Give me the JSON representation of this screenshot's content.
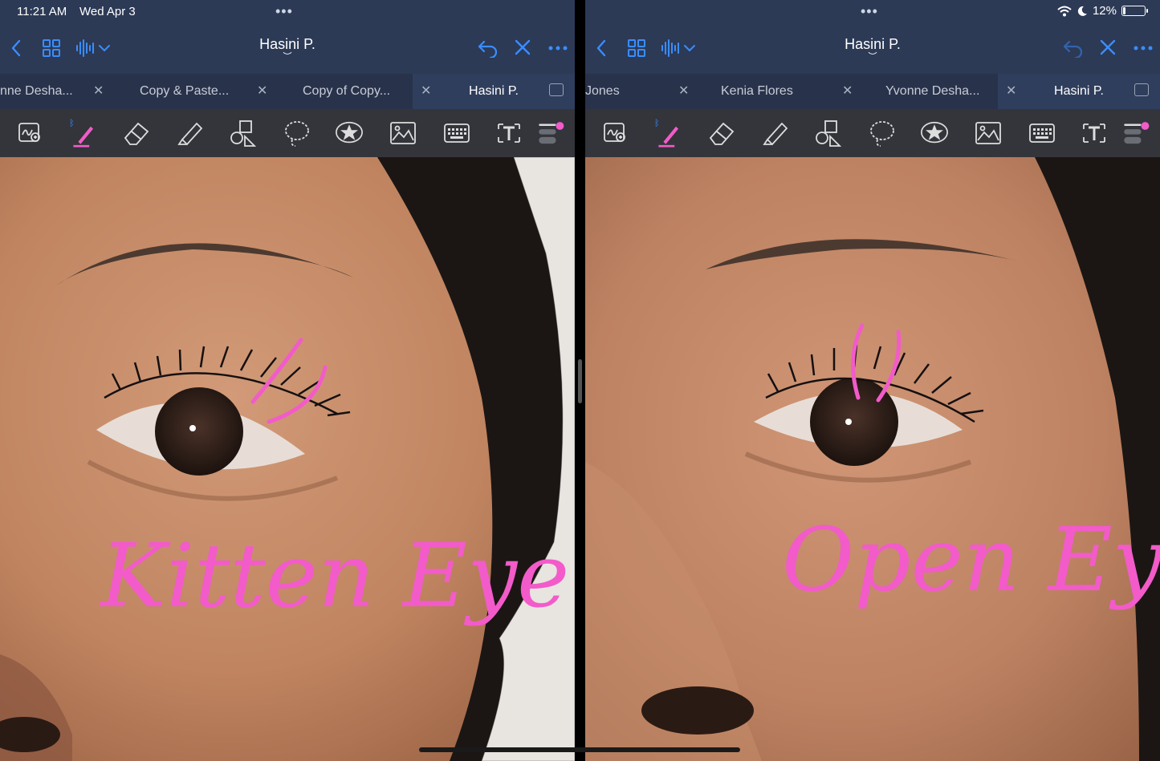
{
  "status": {
    "time": "11:21 AM",
    "date": "Wed Apr 3",
    "battery": "12%",
    "battery_fraction": 0.12
  },
  "colors": {
    "accent": "#3a8dff",
    "ink": "#f25bc9",
    "navbar": "#2c3a56",
    "toolbar": "#33353b"
  },
  "left": {
    "title": "Hasini P.",
    "tabs": [
      {
        "label": "nne Desha..."
      },
      {
        "label": "Copy & Paste..."
      },
      {
        "label": "Copy of Copy..."
      },
      {
        "label": "Hasini P."
      }
    ],
    "ink_text": "Kitten Eye"
  },
  "right": {
    "title": "Hasini P.",
    "tabs": [
      {
        "label": "Jones"
      },
      {
        "label": "Kenia Flores"
      },
      {
        "label": "Yvonne Desha..."
      },
      {
        "label": "Hasini P."
      }
    ],
    "ink_text": "Open Eye"
  },
  "icons": {
    "back": "chevron-left-icon",
    "grid": "grid-icon",
    "audio": "waveform-icon",
    "undo": "undo-icon",
    "close": "close-icon",
    "more": "more-icon",
    "tools": [
      "zoom-lasso-icon",
      "pen-icon",
      "eraser-icon",
      "highlighter-icon",
      "shapes-icon",
      "lasso-icon",
      "sticker-icon",
      "image-icon",
      "keyboard-icon",
      "text-icon",
      "pen-settings-icon"
    ]
  }
}
